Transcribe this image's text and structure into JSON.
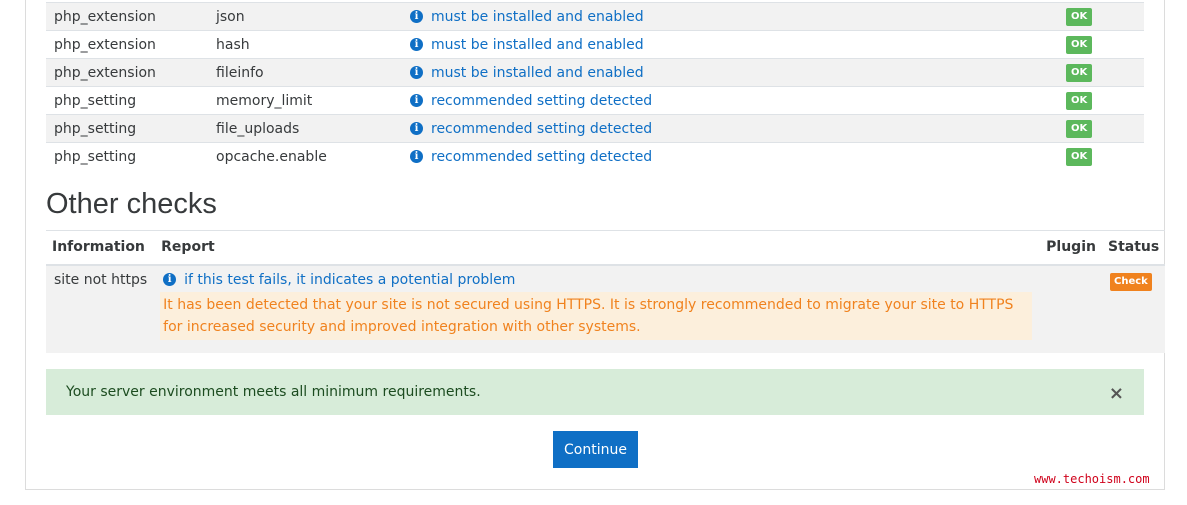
{
  "requirements": [
    {
      "type": "php_extension",
      "name": "json",
      "report": "must be installed and enabled",
      "status": "OK"
    },
    {
      "type": "php_extension",
      "name": "hash",
      "report": "must be installed and enabled",
      "status": "OK"
    },
    {
      "type": "php_extension",
      "name": "fileinfo",
      "report": "must be installed and enabled",
      "status": "OK"
    },
    {
      "type": "php_setting",
      "name": "memory_limit",
      "report": "recommended setting detected",
      "status": "OK"
    },
    {
      "type": "php_setting",
      "name": "file_uploads",
      "report": "recommended setting detected",
      "status": "OK"
    },
    {
      "type": "php_setting",
      "name": "opcache.enable",
      "report": "recommended setting detected",
      "status": "OK"
    }
  ],
  "other_checks": {
    "title": "Other checks",
    "headers": {
      "information": "Information",
      "report": "Report",
      "plugin": "Plugin",
      "status": "Status"
    },
    "rows": [
      {
        "information": "site not https",
        "report_link": "if this test fails, it indicates a potential problem",
        "warning": "It has been detected that your site is not secured using HTTPS. It is strongly recommended to migrate your site to HTTPS for increased security and improved integration with other systems.",
        "plugin": "",
        "status": "Check"
      }
    ]
  },
  "alert": {
    "message": "Your server environment meets all minimum requirements.",
    "close_label": "×"
  },
  "continue_label": "Continue",
  "watermark": "www.techoism.com",
  "colors": {
    "link": "#0f6fc5",
    "ok": "#5cb85c",
    "warning": "#f0821e",
    "alert_bg": "#d7ecd9"
  }
}
